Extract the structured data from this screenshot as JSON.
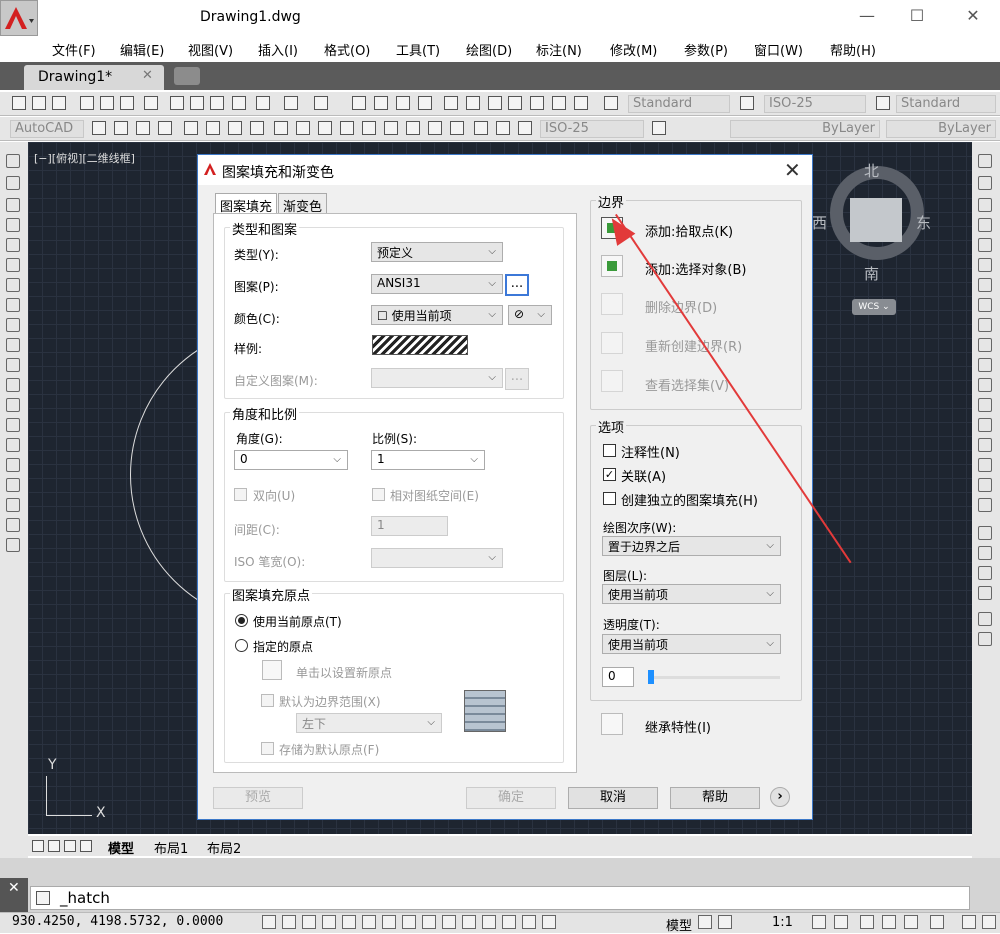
{
  "window": {
    "title": "Drawing1.dwg",
    "minimize": "—",
    "maximize": "☐",
    "close": "✕"
  },
  "menu": [
    "文件(F)",
    "编辑(E)",
    "视图(V)",
    "插入(I)",
    "格式(O)",
    "工具(T)",
    "绘图(D)",
    "标注(N)",
    "修改(M)",
    "参数(P)",
    "窗口(W)",
    "帮助(H)"
  ],
  "doc_tab": {
    "label": "Drawing1*",
    "close": "✕"
  },
  "toolbar": {
    "text_style": "Standard",
    "dim_style": "ISO-25",
    "table_style": "Standard",
    "workspace": "AutoCAD",
    "dim_style2": "ISO-25",
    "linetype": "ByLayer",
    "lineweight": "ByLayer"
  },
  "viewport": {
    "label": "[−][俯视][二维线框]",
    "compass": {
      "n": "北",
      "s": "南",
      "e": "东",
      "w": "西"
    },
    "wcs": "WCS ⌄",
    "ucs_x": "X",
    "ucs_y": "Y"
  },
  "layout_tabs": [
    "模型",
    "布局1",
    "布局2"
  ],
  "command": {
    "close": "✕",
    "text": "_hatch"
  },
  "status": {
    "coords": "930.4250,   4198.5732,  0.0000",
    "model": "模型",
    "scale": "1:1"
  },
  "dialog": {
    "title": "图案填充和渐变色",
    "close": "✕",
    "tabs": [
      "图案填充",
      "渐变色"
    ],
    "type_group": "类型和图案",
    "type_label": "类型(Y):",
    "type_value": "预定义",
    "pattern_label": "图案(P):",
    "pattern_value": "ANSI31",
    "browse": "...",
    "color_label": "颜色(C):",
    "color_value": "使用当前项",
    "sample_label": "样例:",
    "custom_label": "自定义图案(M):",
    "custom_browse": "...",
    "angle_group": "角度和比例",
    "angle_label": "角度(G):",
    "angle_value": "0",
    "scale_label": "比例(S):",
    "scale_value": "1",
    "double_label": "双向(U)",
    "relative_label": "相对图纸空间(E)",
    "spacing_label": "间距(C):",
    "spacing_value": "1",
    "iso_label": "ISO 笔宽(O):",
    "origin_group": "图案填充原点",
    "origin_current": "使用当前原点(T)",
    "origin_specified": "指定的原点",
    "click_origin": "单击以设置新原点",
    "default_extent": "默认为边界范围(X)",
    "extent_value": "左下",
    "store_default": "存储为默认原点(F)",
    "boundary_group": "边界",
    "add_pick": "添加:拾取点(K)",
    "add_select": "添加:选择对象(B)",
    "remove_boundary": "删除边界(D)",
    "recreate_boundary": "重新创建边界(R)",
    "view_selection": "查看选择集(V)",
    "options_group": "选项",
    "annotative": "注释性(N)",
    "associative": "关联(A)",
    "separate": "创建独立的图案填充(H)",
    "draw_order_label": "绘图次序(W):",
    "draw_order_value": "置于边界之后",
    "layer_label": "图层(L):",
    "layer_value": "使用当前项",
    "transparency_label": "透明度(T):",
    "transparency_select": "使用当前项",
    "transparency_value": "0",
    "inherit": "继承特性(I)",
    "preview": "预览",
    "ok": "确定",
    "cancel": "取消",
    "help": "帮助",
    "more": "›"
  }
}
